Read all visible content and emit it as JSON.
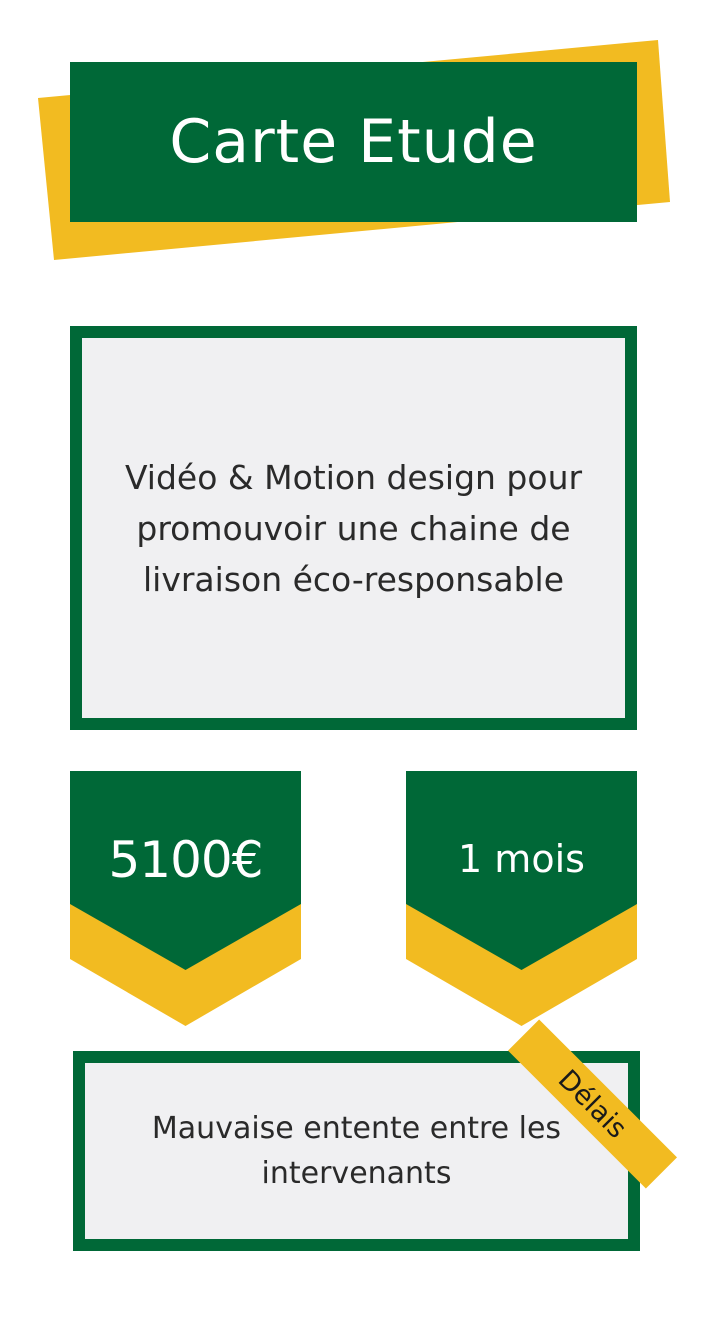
{
  "title": "Carte Etude",
  "description": "Vidéo & Motion design pour promouvoir une chaine de livraison éco-responsable",
  "price": "5100€",
  "duration": "1 mois",
  "risk": {
    "text": "Mauvaise entente entre les intervenants",
    "tag": "Délais"
  },
  "colors": {
    "green": "#006837",
    "yellow": "#f2bb21",
    "panel": "#f0f0f2"
  }
}
